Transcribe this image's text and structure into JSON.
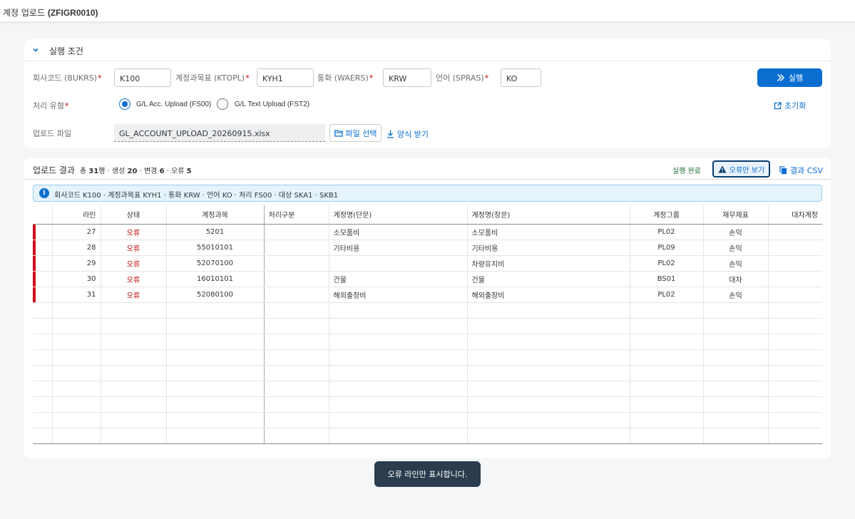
{
  "app": {
    "title_prefix": "계정 업로드 ",
    "title_code": "(ZFIGR0010)"
  },
  "conditions": {
    "section_title": "실행 조건",
    "fields": {
      "company_code": {
        "label": "회사코드 (BUKRS)",
        "value": "K100"
      },
      "chart_of_accounts": {
        "label": "계정과목표 (KTOPL)",
        "value": "KYH1"
      },
      "currency": {
        "label": "통화 (WAERS)",
        "value": "KRW"
      },
      "language": {
        "label": "언어 (SPRAS)",
        "value": "KO"
      }
    },
    "required_mark": "*",
    "process_type": {
      "label": "처리 유형",
      "options": [
        "G/L Acc. Upload (FS00)",
        "G/L Text Upload (FST2)"
      ],
      "selected": "G/L Acc. Upload (FS00)"
    },
    "upload_file": {
      "label": "업로드 파일",
      "value": "GL_ACCOUNT_UPLOAD_20260915.xlsx"
    },
    "file_select_label": "파일 선택",
    "template_download_label": "양식 받기",
    "run_label": "실행",
    "reset_label": "초기화"
  },
  "results": {
    "title": "업로드 결과",
    "summary": {
      "p1": "총 ",
      "total": "31",
      "p2": "행 · 생성 ",
      "created": "20",
      "p3": " · 변경 ",
      "changed": "6",
      "p4": " · 오류 ",
      "errors": "5"
    },
    "status": "실행 완료",
    "errors_only_label": "오류만 보기",
    "csv_label": "결과 CSV",
    "info": "회사코드 K100 · 계정과목표 KYH1 · 통화 KRW · 언어 KO · 처리 FS00 · 대상 SKA1 · SKB1",
    "columns": [
      "라인",
      "상태",
      "계정과목",
      "처리구분",
      "계정명(단문)",
      "계정명(장문)",
      "계정그룹",
      "재무제표",
      "대차계정"
    ],
    "rows": [
      {
        "line": "27",
        "status": "오류",
        "account": "5201",
        "proc": "",
        "short": "소모품비",
        "long": "소모품비",
        "group": "PL02",
        "fs": "손익",
        "bs": ""
      },
      {
        "line": "28",
        "status": "오류",
        "account": "55010101",
        "proc": "",
        "short": "기타비용",
        "long": "기타비용",
        "group": "PL09",
        "fs": "손익",
        "bs": ""
      },
      {
        "line": "29",
        "status": "오류",
        "account": "52070100",
        "proc": "",
        "short": "",
        "long": "차량유지비",
        "group": "PL02",
        "fs": "손익",
        "bs": ""
      },
      {
        "line": "30",
        "status": "오류",
        "account": "16010101",
        "proc": "",
        "short": "건물",
        "long": "건물",
        "group": "BS01",
        "fs": "대차",
        "bs": ""
      },
      {
        "line": "31",
        "status": "오류",
        "account": "52080100",
        "proc": "",
        "short": "해외출장비",
        "long": "해외출장비",
        "group": "PL02",
        "fs": "손익",
        "bs": ""
      }
    ],
    "empty_rows": 9
  },
  "toast": "오류 라인만 표시합니다.",
  "colors": {
    "accent": "#0a6ed1",
    "error": "#bb0000",
    "error_marker": "#d0021b",
    "success": "#256f3a",
    "toast_bg": "#2b3c4e"
  }
}
